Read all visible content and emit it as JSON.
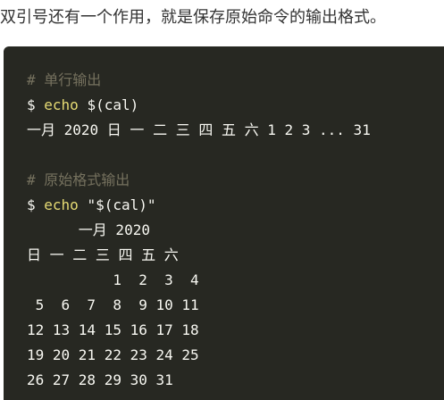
{
  "intro_text": "双引号还有一个作用，就是保存原始命令的输出格式。",
  "code": {
    "comment_1": "# 单行输出",
    "cmd_1": {
      "prompt": "$",
      "keyword": "echo",
      "args": "$(cal)"
    },
    "output_1": "一月 2020 日 一 二 三 四 五 六 1 2 3 ... 31",
    "comment_2": "# 原始格式输出",
    "cmd_2": {
      "prompt": "$",
      "keyword": "echo",
      "args": "\"$(cal)\""
    },
    "calendar": {
      "title": "      一月 2020",
      "weekdays": "日 一 二 三 四 五 六",
      "rows": [
        "          1  2  3  4",
        " 5  6  7  8  9 10 11",
        "12 13 14 15 16 17 18",
        "19 20 21 22 23 24 25",
        "26 27 28 29 30 31"
      ]
    }
  },
  "colors": {
    "code_background": "#272822",
    "comment": "#75715e",
    "keyword": "#e6db74",
    "text": "#f8f8f2"
  }
}
